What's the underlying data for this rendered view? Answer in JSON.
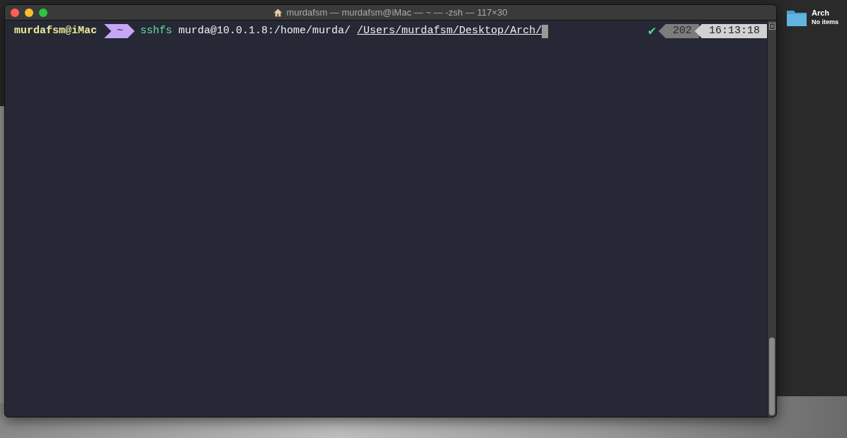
{
  "window": {
    "title": "murdafsm — murdafsm@iMac — ~ — -zsh — 117×30"
  },
  "prompt": {
    "user_host": "murdafsm@iMac",
    "directory": "~",
    "command": "sshfs",
    "arguments": "murda@10.0.1.8:/home/murda/",
    "path": "/Users/murdafsm/Desktop/Arch/",
    "status_ok": true,
    "status_mark": "✔",
    "segment_number": "202",
    "time": "16:13:18"
  },
  "desktop_icons": [
    {
      "label": "Arch",
      "detail": "No items"
    }
  ]
}
